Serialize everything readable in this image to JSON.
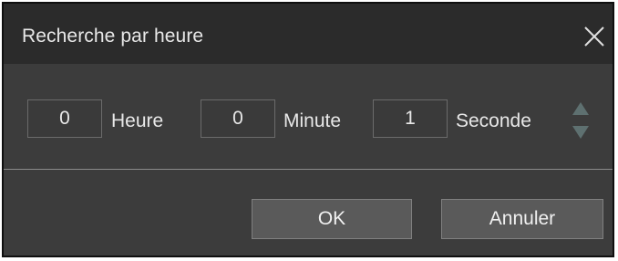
{
  "dialog": {
    "title": "Recherche par heure",
    "close_icon": "close-icon"
  },
  "fields": {
    "hours": {
      "value": "0",
      "label": "Heure"
    },
    "minutes": {
      "value": "0",
      "label": "Minute"
    },
    "seconds": {
      "value": "1",
      "label": "Seconde"
    }
  },
  "spinner": {
    "up_icon": "triangle-up-icon",
    "down_icon": "triangle-down-icon"
  },
  "buttons": {
    "ok_label": "OK",
    "cancel_label": "Annuler"
  },
  "colors": {
    "titlebar": "#2b2b2b",
    "body": "#3c3c3c",
    "button": "#5a5a5a",
    "spinner": "#5e7070"
  }
}
